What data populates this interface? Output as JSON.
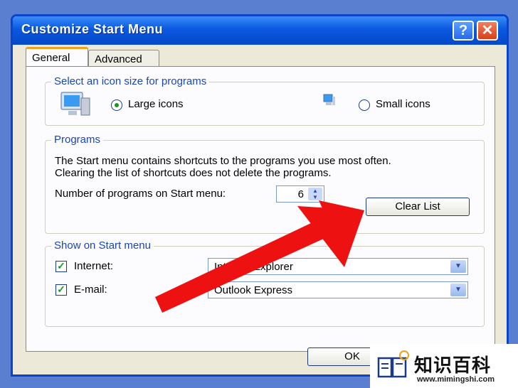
{
  "window": {
    "title": "Customize Start Menu"
  },
  "tabs": [
    {
      "label": "General"
    },
    {
      "label": "Advanced"
    }
  ],
  "icon_size": {
    "group_label": "Select an icon size for programs",
    "large_label": "Large icons",
    "small_label": "Small icons",
    "selected": "Large icons"
  },
  "programs": {
    "group_label": "Programs",
    "description_line1": "The Start menu contains shortcuts to the programs you use most often.",
    "description_line2": "Clearing the list of shortcuts does not delete the programs.",
    "count_label": "Number of programs on Start menu:",
    "count_value": "6",
    "clear_button": "Clear List"
  },
  "show_on_start": {
    "group_label": "Show on Start menu",
    "internet_label": "Internet:",
    "internet_value": "Internet Explorer",
    "email_label": "E-mail:",
    "email_value": "Outlook Express"
  },
  "footer": {
    "ok_button": "OK"
  },
  "watermark": {
    "text": "知识百科",
    "url": "www.mimingshi.com"
  },
  "colors": {
    "title_blue": "#0a58e0",
    "group_label": "#1a46b8",
    "arrow_red": "#ee1111"
  }
}
